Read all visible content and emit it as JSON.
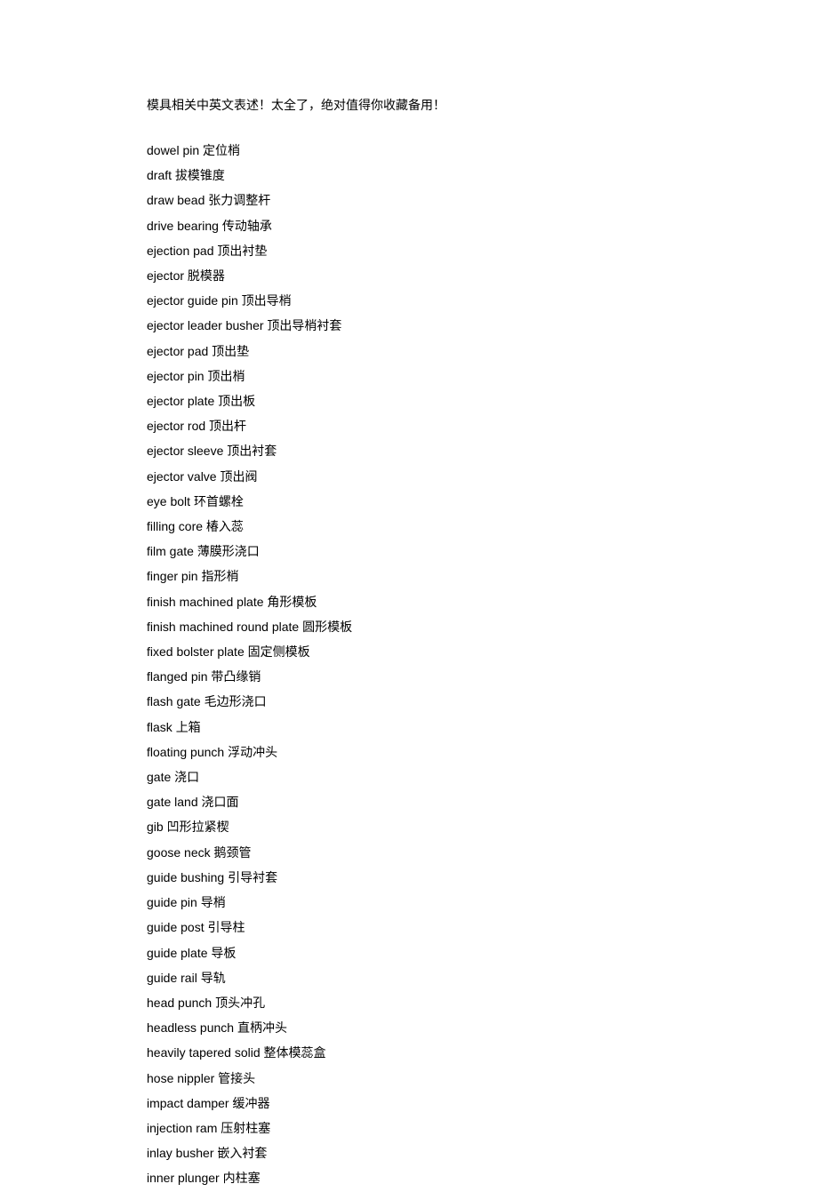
{
  "title": "模具相关中英文表述！太全了，绝对值得你收藏备用！",
  "terms": [
    {
      "en": "dowel pin",
      "zh": "定位梢"
    },
    {
      "en": "draft",
      "zh": "拔模锥度"
    },
    {
      "en": "draw bead",
      "zh": "张力调整杆"
    },
    {
      "en": "drive bearing",
      "zh": "传动轴承"
    },
    {
      "en": "ejection pad",
      "zh": "顶出衬垫"
    },
    {
      "en": "ejector",
      "zh": "脱模器"
    },
    {
      "en": "ejector guide pin",
      "zh": "顶出导梢"
    },
    {
      "en": "ejector leader busher",
      "zh": "顶出导梢衬套"
    },
    {
      "en": "ejector pad",
      "zh": "顶出垫"
    },
    {
      "en": "ejector pin",
      "zh": "顶出梢"
    },
    {
      "en": "ejector plate",
      "zh": "顶出板"
    },
    {
      "en": "ejector rod",
      "zh": "顶出杆"
    },
    {
      "en": "ejector sleeve",
      "zh": "顶出衬套"
    },
    {
      "en": "ejector valve",
      "zh": "顶出阀"
    },
    {
      "en": "eye bolt",
      "zh": "环首螺栓"
    },
    {
      "en": "filling core",
      "zh": "椿入蕊"
    },
    {
      "en": "film gate",
      "zh": "薄膜形浇口"
    },
    {
      "en": "finger pin",
      "zh": "指形梢"
    },
    {
      "en": "finish machined plate",
      "zh": "角形模板"
    },
    {
      "en": "finish machined round plate",
      "zh": "圆形模板"
    },
    {
      "en": "fixed bolster plate",
      "zh": "固定侧模板"
    },
    {
      "en": "flanged pin",
      "zh": "带凸缘销"
    },
    {
      "en": "flash gate",
      "zh": "毛边形浇口"
    },
    {
      "en": "flask",
      "zh": "上箱"
    },
    {
      "en": "floating punch",
      "zh": "浮动冲头"
    },
    {
      "en": "gate",
      "zh": "浇口"
    },
    {
      "en": "gate land",
      "zh": "浇口面"
    },
    {
      "en": "gib",
      "zh": "凹形拉紧楔"
    },
    {
      "en": "goose neck",
      "zh": "鹅颈管"
    },
    {
      "en": "guide bushing",
      "zh": "引导衬套"
    },
    {
      "en": "guide pin",
      "zh": "导梢"
    },
    {
      "en": "guide post",
      "zh": "引导柱"
    },
    {
      "en": "guide plate",
      "zh": "导板"
    },
    {
      "en": "guide rail",
      "zh": "导轨"
    },
    {
      "en": "head punch",
      "zh": "顶头冲孔"
    },
    {
      "en": "headless punch",
      "zh": "直柄冲头"
    },
    {
      "en": "heavily tapered solid",
      "zh": "整体模蕊盒"
    },
    {
      "en": "hose nippler",
      "zh": "管接头"
    },
    {
      "en": "impact damper",
      "zh": "缓冲器"
    },
    {
      "en": "injection ram",
      "zh": "压射柱塞"
    },
    {
      "en": "inlay busher",
      "zh": "嵌入衬套"
    },
    {
      "en": "inner plunger",
      "zh": "内柱塞"
    }
  ]
}
